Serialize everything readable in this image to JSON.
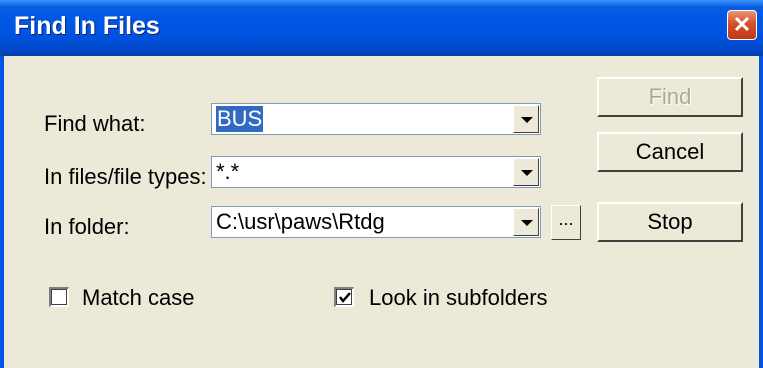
{
  "dialog": {
    "title": "Find In Files",
    "close_glyph": "✕"
  },
  "form": {
    "find_what_label": "Find what:",
    "find_what_value": "BUS",
    "file_types_label": "In files/file types:",
    "file_types_value": "*.*",
    "folder_label": "In folder:",
    "folder_value": "C:\\usr\\paws\\Rtdg",
    "browse_label": "..."
  },
  "buttons": {
    "find": "Find",
    "cancel": "Cancel",
    "stop": "Stop"
  },
  "options": {
    "match_case_label": "Match case",
    "match_case_checked": false,
    "subfolders_label": "Look in subfolders",
    "subfolders_checked": true
  },
  "icons": {
    "close": "close-icon",
    "dropdown": "chevron-down-icon",
    "check": "checkmark-icon"
  },
  "colors": {
    "title_bar": "#0054e3",
    "dialog_bg": "#ece9d8",
    "selection": "#316ac5",
    "close_button": "#d4502a",
    "disabled_text": "#aca899"
  }
}
